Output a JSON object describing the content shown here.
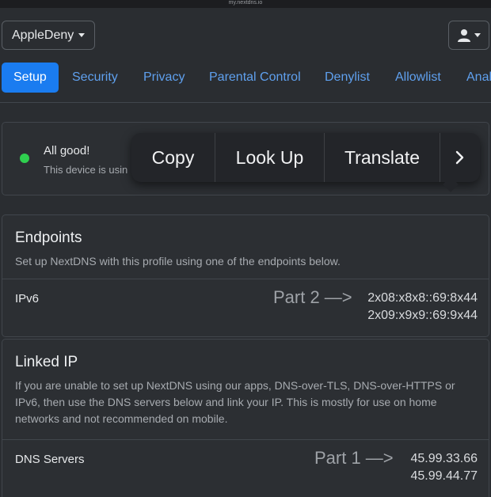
{
  "browser": {
    "url": "my.nextdns.io"
  },
  "header": {
    "profile_name": "AppleDeny"
  },
  "tabs": [
    {
      "label": "Setup",
      "active": true
    },
    {
      "label": "Security"
    },
    {
      "label": "Privacy"
    },
    {
      "label": "Parental Control"
    },
    {
      "label": "Denylist"
    },
    {
      "label": "Allowlist"
    },
    {
      "label": "Anal"
    }
  ],
  "status": {
    "title": "All good!",
    "subtitle": "This device is usin"
  },
  "context_menu": {
    "items": [
      "Copy",
      "Look Up",
      "Translate"
    ],
    "more": "›"
  },
  "endpoints": {
    "title": "Endpoints",
    "description": "Set up NextDNS with this profile using one of the endpoints below.",
    "ipv6": {
      "label": "IPv6",
      "annotation": "Part 2 —>",
      "addresses": [
        "2x08:x8x8::69:8x44",
        "2x09:x9x9::69:9x44"
      ]
    }
  },
  "linked_ip": {
    "title": "Linked IP",
    "description_lines": [
      "If you are unable to set up NextDNS using our apps, DNS-over-TLS, DNS-over-HTTPS or",
      "IPv6, then use the DNS servers below and link your IP. This is mostly for use on home",
      "networks and not recommended on mobile."
    ],
    "dns": {
      "label": "DNS Servers",
      "annotation": "Part 1 —>",
      "addresses": [
        "45.99.33.66",
        "45.99.44.77"
      ]
    }
  },
  "colors": {
    "accent": "#1a7cf0",
    "link": "#5fa0ee",
    "ok": "#2fcf4f",
    "background": "#2a2d31"
  }
}
